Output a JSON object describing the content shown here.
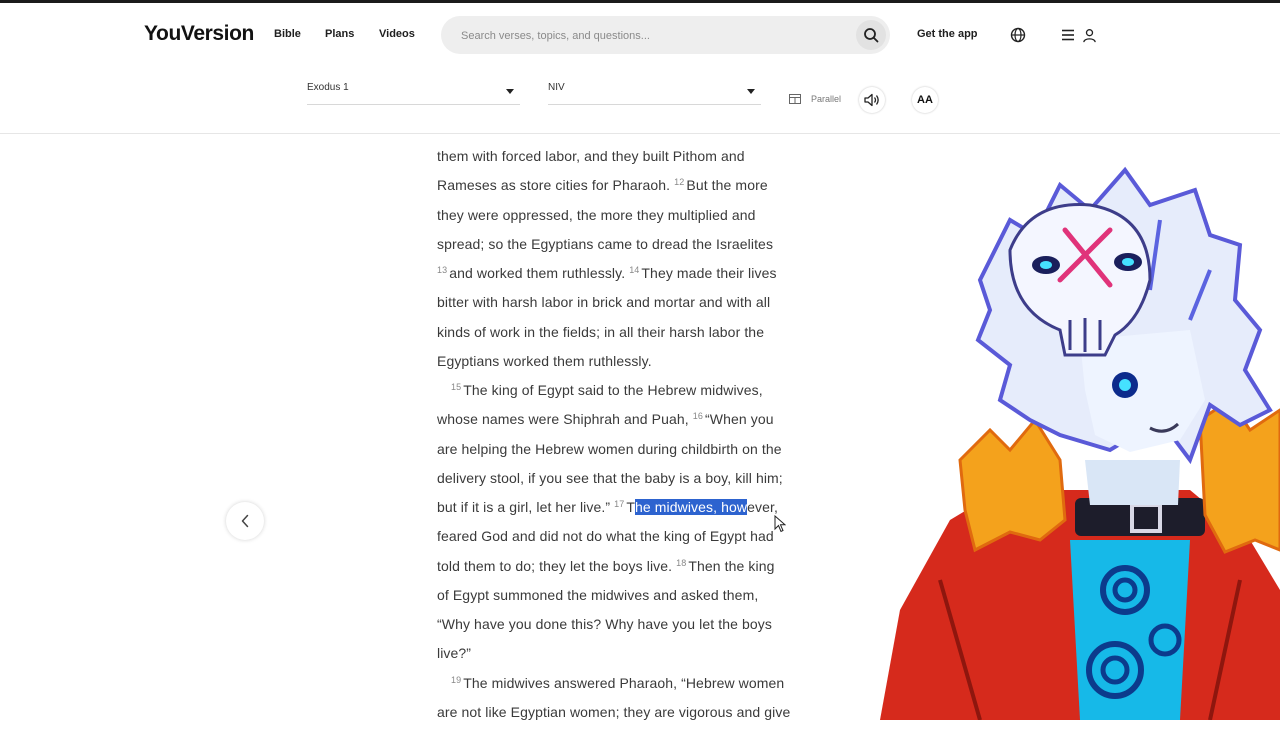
{
  "header": {
    "logo": "YouVersion",
    "nav": [
      "Bible",
      "Plans",
      "Videos"
    ],
    "search_placeholder": "Search verses, topics, and questions...",
    "get_app": "Get the app",
    "icons": [
      "search-icon",
      "globe-icon",
      "menu-icon",
      "user-icon"
    ]
  },
  "toolbar": {
    "book_chapter": "Exodus 1",
    "version": "NIV",
    "parallel": "Parallel",
    "font_size_label": "AA",
    "icons": [
      "parallel-icon",
      "audio-icon"
    ]
  },
  "reader": {
    "l1": "them with forced labor, and they built Pithom and",
    "l2a": "Rameses as store cities for Pharaoh.",
    "v12": "12",
    "l2b": "But the more",
    "l3": "they were oppressed, the more they multiplied and",
    "l4": "spread; so the Egyptians came to dread the Israelites",
    "v13": "13",
    "l5a": "and worked them ruthlessly.",
    "v14": "14",
    "l5b": "They made their lives",
    "l6": "bitter with harsh labor in brick and mortar and with all",
    "l7": "kinds of work in the fields; in all their harsh labor the",
    "l8": "Egyptians worked them ruthlessly.",
    "v15": "15",
    "l9": "The king of Egypt said to the Hebrew midwives,",
    "l10a": "whose names were Shiphrah and Puah,",
    "v16": "16",
    "l10b": "“When you",
    "l11": "are helping the Hebrew women during childbirth on the",
    "l12": "delivery stool, if you see that the baby is a boy, kill him;",
    "l13a": "but if it is a girl, let her live.”",
    "v17": "17",
    "l13b": "T",
    "l13hl": "he midwives, how",
    "l13c": "ever,",
    "l14": "feared God and did not do what the king of Egypt had",
    "l15a": "told them to do; they let the boys live.",
    "v18": "18",
    "l15b": "Then the king",
    "l16": "of Egypt summoned the midwives and asked them,",
    "l17": "“Why have you done this? Why have you let the boys",
    "l18": "live?”",
    "v19": "19",
    "l19": "The midwives answered Pharaoh, “Hebrew women",
    "l20": "are not like Egyptian women; they are vigorous and give"
  },
  "nav_controls": {
    "prev_icon": "chevron-left-icon"
  },
  "colors": {
    "highlight": "#2d63cf",
    "text": "#3a3a3a",
    "verse_number": "#888888"
  }
}
